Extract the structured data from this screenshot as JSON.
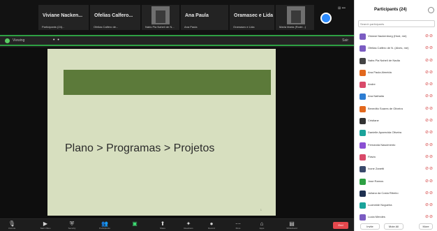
{
  "gallery": {
    "tiles": [
      {
        "name": "Viviane Nacken...",
        "sub": "Participants (24)..."
      },
      {
        "name": "Ofelias Calfero...",
        "sub": "Ofelias Calfero de..."
      },
      {
        "name": "",
        "sub": "Nabs Pia Naheli de N..."
      },
      {
        "name": "Ana Paula",
        "sub": "Ana Paula"
      },
      {
        "name": "Oramasec e Lida",
        "sub": "Oramasec e Lida"
      },
      {
        "name": "",
        "sub": "Maria Marta (Rodri...)"
      }
    ],
    "more_label": "⊞ •••"
  },
  "share_bar": {
    "view_label": "Viewing",
    "dots": "• •",
    "right_label": "Sair"
  },
  "slide": {
    "text": "Plano > Programas > Projetos",
    "footer": "1"
  },
  "controls": {
    "items": [
      {
        "glyph": "🎙",
        "label": "Unmute",
        "name": "mute-button"
      },
      {
        "glyph": "▶",
        "label": "Start Video",
        "name": "video-button"
      },
      {
        "glyph": "⛨",
        "label": "Security",
        "name": "security-button"
      },
      {
        "glyph": "👥",
        "label": "Participants",
        "name": "participants-button"
      },
      {
        "glyph": "▣",
        "label": "",
        "name": "chat-button"
      },
      {
        "glyph": "⬆",
        "label": "Share",
        "name": "share-button"
      },
      {
        "glyph": "✦",
        "label": "Reactions",
        "name": "reactions-button"
      },
      {
        "glyph": "●",
        "label": "Record",
        "name": "record-button"
      },
      {
        "glyph": "⋯",
        "label": "More",
        "name": "more-button"
      },
      {
        "glyph": "⌂",
        "label": "Apps",
        "name": "apps-button"
      },
      {
        "glyph": "▤",
        "label": "Whiteboard",
        "name": "whiteboard-button"
      }
    ],
    "end_label": "End"
  },
  "panel": {
    "title": "Participants (24)",
    "search_placeholder": "Search participants",
    "participants": [
      {
        "name": "Viviane Nackenborg (Host, me)",
        "color": "#7b5cc2"
      },
      {
        "name": "Ofelias Calfero de N. (Alves, me)",
        "color": "#7b5cc2"
      },
      {
        "name": "Nabs Pia Naheli de Nadia",
        "color": "#444444"
      },
      {
        "name": "Ana Paula Almeida",
        "color": "#e2681e"
      },
      {
        "name": "Andre",
        "color": "#d94a6a"
      },
      {
        "name": "Ana Nathalia",
        "color": "#2d7dd2"
      },
      {
        "name": "Benedito Soares de Oliveira",
        "color": "#e2681e"
      },
      {
        "name": "Cristiane",
        "color": "#333333"
      },
      {
        "name": "Danielle Aparecida Oliveira",
        "color": "#1aa39a"
      },
      {
        "name": "Fernanda Nascimento",
        "color": "#8a4fd3"
      },
      {
        "name": "Flavia",
        "color": "#d94a6a"
      },
      {
        "name": "Ivone Zanetti",
        "color": "#3a4a6b"
      },
      {
        "name": "Jose Ramos",
        "color": "#2ea043"
      },
      {
        "name": "Juliana da Costa Ribeiro",
        "color": "#1e3050"
      },
      {
        "name": "Lucineide Nogueira",
        "color": "#1aa39a"
      },
      {
        "name": "Lucia Mendes",
        "color": "#7b5cc2"
      }
    ],
    "footer_buttons": [
      "Invite",
      "Mute All",
      "More"
    ]
  },
  "colors": {
    "share_border": "#2ea043",
    "slide_bg": "#d7dfbf",
    "slide_header": "#5c7a3a",
    "end_red": "#e5484d"
  }
}
